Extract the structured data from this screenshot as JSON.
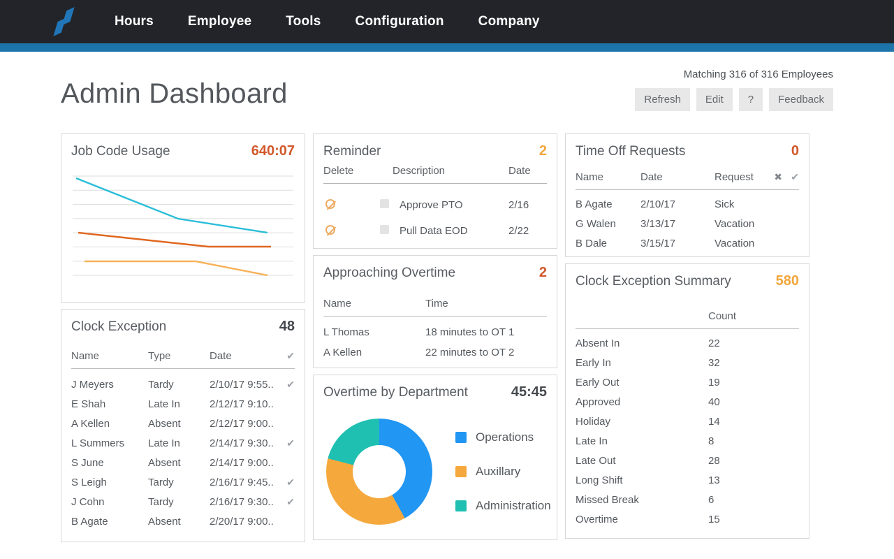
{
  "nav": {
    "items": [
      "Hours",
      "Employee",
      "Tools",
      "Configuration",
      "Company"
    ]
  },
  "header": {
    "title": "Admin Dashboard",
    "matching": "Matching 316 of 316 Employees",
    "buttons": {
      "refresh": "Refresh",
      "edit": "Edit",
      "help": "?",
      "feedback": "Feedback"
    }
  },
  "cards": {
    "job_code_usage": {
      "title": "Job Code Usage",
      "value": "640:07"
    },
    "clock_exception": {
      "title": "Clock Exception",
      "value": "48",
      "columns": [
        "Name",
        "Type",
        "Date"
      ],
      "header_check_icon": "✔",
      "rows": [
        {
          "name": "J Meyers",
          "type": "Tardy",
          "date": "2/10/17 9:55..",
          "check": "✔"
        },
        {
          "name": "E Shah",
          "type": "Late In",
          "date": "2/12/17 9:10..",
          "check": ""
        },
        {
          "name": "A Kellen",
          "type": "Absent",
          "date": "2/12/17 9:00..",
          "check": ""
        },
        {
          "name": "L Summers",
          "type": "Late In",
          "date": "2/14/17 9:30..",
          "check": "✔"
        },
        {
          "name": "S June",
          "type": "Absent",
          "date": "2/14/17 9:00..",
          "check": ""
        },
        {
          "name": "S Leigh",
          "type": "Tardy",
          "date": "2/16/17 9:45..",
          "check": "✔"
        },
        {
          "name": "J Cohn",
          "type": "Tardy",
          "date": "2/16/17 9:30..",
          "check": "✔"
        },
        {
          "name": "B Agate",
          "type": "Absent",
          "date": "2/20/17 9:00..",
          "check": ""
        }
      ]
    },
    "reminder": {
      "title": "Reminder",
      "value": "2",
      "columns": [
        "Delete",
        "Description",
        "Date"
      ],
      "rows": [
        {
          "description": "Approve PTO",
          "date": "2/16"
        },
        {
          "description": "Pull Data EOD",
          "date": "2/22"
        }
      ]
    },
    "approaching_overtime": {
      "title": "Approaching Overtime",
      "value": "2",
      "columns": [
        "Name",
        "Time"
      ],
      "rows": [
        {
          "name": "L Thomas",
          "time": "18 minutes to OT 1"
        },
        {
          "name": "A Kellen",
          "time": "22 minutes to OT 2"
        }
      ]
    },
    "overtime_by_department": {
      "title": "Overtime by Department",
      "value": "45:45"
    },
    "time_off_requests": {
      "title": "Time Off Requests",
      "value": "0",
      "columns": [
        "Name",
        "Date",
        "Request"
      ],
      "header_deny_icon": "✖",
      "header_approve_icon": "✔",
      "rows": [
        {
          "name": "B Agate",
          "date": "2/10/17",
          "request": "Sick"
        },
        {
          "name": "G Walen",
          "date": "3/13/17",
          "request": "Vacation"
        },
        {
          "name": "B Dale",
          "date": "3/15/17",
          "request": "Vacation"
        }
      ]
    },
    "clock_exception_summary": {
      "title": "Clock Exception Summary",
      "value": "580",
      "count_header": "Count",
      "rows": [
        {
          "label": "Absent In",
          "count": "22"
        },
        {
          "label": "Early In",
          "count": "32"
        },
        {
          "label": "Early Out",
          "count": "19"
        },
        {
          "label": "Approved",
          "count": "40"
        },
        {
          "label": "Holiday",
          "count": "14"
        },
        {
          "label": "Late In",
          "count": "8"
        },
        {
          "label": "Late Out",
          "count": "28"
        },
        {
          "label": "Long Shift",
          "count": "13"
        },
        {
          "label": "Missed Break",
          "count": "6"
        },
        {
          "label": "Overtime",
          "count": "15"
        }
      ]
    }
  },
  "chart_data": [
    {
      "type": "line",
      "title": "Job Code Usage",
      "total": "640:07",
      "xlabel": "",
      "ylabel": "",
      "axis_labels_visible": false,
      "gridline_count": 8,
      "note": "three declining series, values unlabeled; points given as svg coords of 320x160 plot, y aligned to gridlines",
      "series": [
        {
          "name": "series-teal",
          "color": "#29bdd8",
          "points": [
            [
              7,
              13
            ],
            [
              153,
              71
            ],
            [
              281,
              91
            ]
          ]
        },
        {
          "name": "series-orange",
          "color": "#e0671f",
          "points": [
            [
              10,
              91
            ],
            [
              196,
              111
            ],
            [
              286,
              111
            ]
          ]
        },
        {
          "name": "series-amber",
          "color": "#f8b158",
          "points": [
            [
              19,
              132
            ],
            [
              178,
              132
            ],
            [
              281,
              152
            ]
          ]
        }
      ]
    },
    {
      "type": "pie",
      "title": "Overtime by Department",
      "total": "45:45",
      "labels": [
        "Operations",
        "Auxillary",
        "Administration"
      ],
      "values": [
        42,
        37,
        21
      ],
      "colors": [
        "#2196f3",
        "#f5a93d",
        "#1fc0b2"
      ],
      "legend_position": "right",
      "donut": true
    }
  ],
  "colors": {
    "nav_bg": "#232429",
    "accent_blue": "#1d74ab",
    "dark_orange": "#d2572b",
    "amber": "#f2a63c",
    "grid_line": "#dddddd"
  }
}
